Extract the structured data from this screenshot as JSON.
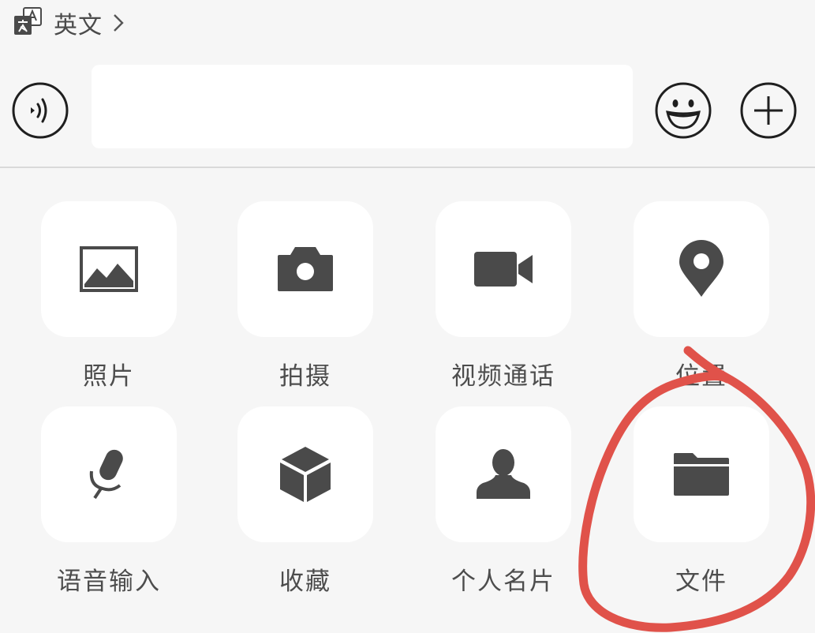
{
  "language": {
    "label": "英文"
  },
  "input": {
    "placeholder": "",
    "value": ""
  },
  "tools": [
    {
      "id": "photo",
      "label": "照片",
      "icon": "image-icon"
    },
    {
      "id": "camera",
      "label": "拍摄",
      "icon": "camera-icon"
    },
    {
      "id": "video-call",
      "label": "视频通话",
      "icon": "video-camera-icon"
    },
    {
      "id": "location",
      "label": "位置",
      "icon": "location-pin-icon"
    },
    {
      "id": "voice-input",
      "label": "语音输入",
      "icon": "microphone-icon"
    },
    {
      "id": "favorites",
      "label": "收藏",
      "icon": "cube-icon"
    },
    {
      "id": "contact-card",
      "label": "个人名片",
      "icon": "person-icon"
    },
    {
      "id": "file",
      "label": "文件",
      "icon": "folder-icon"
    }
  ],
  "colors": {
    "background": "#f6f6f6",
    "tile": "#ffffff",
    "icon": "#4a4a4a",
    "annotation": "#e0524a"
  }
}
